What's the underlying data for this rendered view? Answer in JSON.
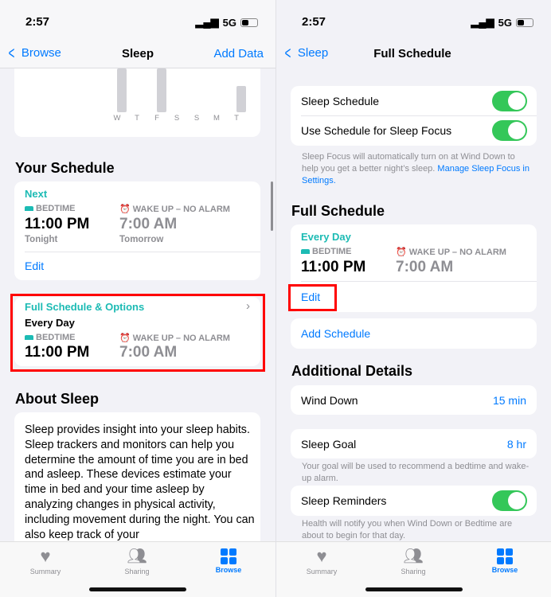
{
  "colors": {
    "accent": "#007aff",
    "teal": "#1cbbb4",
    "toggle_on": "#34c759",
    "highlight": "#ff0000"
  },
  "status": {
    "time": "2:57",
    "network": "5G"
  },
  "left": {
    "nav": {
      "back": "Browse",
      "title": "Sleep",
      "right": "Add Data"
    },
    "chart": {
      "days": [
        "W",
        "T",
        "F",
        "S",
        "S",
        "M",
        "T"
      ]
    },
    "your_schedule": {
      "title": "Your Schedule",
      "next": "Next",
      "bedtime_label": "BEDTIME",
      "bedtime": "11:00 PM",
      "bedtime_sub": "Tonight",
      "wake_label": "WAKE UP – NO ALARM",
      "wake": "7:00 AM",
      "wake_sub": "Tomorrow",
      "edit": "Edit"
    },
    "full_options": {
      "title": "Full Schedule & Options",
      "days": "Every Day",
      "bedtime_label": "BEDTIME",
      "bedtime": "11:00 PM",
      "wake_label": "WAKE UP – NO ALARM",
      "wake": "7:00 AM"
    },
    "about": {
      "title": "About Sleep",
      "text": "Sleep provides insight into your sleep habits. Sleep trackers and monitors can help you determine the amount of time you are in bed and asleep. These devices estimate your time in bed and your time asleep by analyzing changes in physical activity, including movement during the night. You can also keep track of your"
    }
  },
  "right": {
    "nav": {
      "back": "Sleep",
      "title": "Full Schedule"
    },
    "toggles": [
      {
        "label": "Sleep Schedule",
        "on": true
      },
      {
        "label": "Use Schedule for Sleep Focus",
        "on": true
      }
    ],
    "focus_note": "Sleep Focus will automatically turn on at Wind Down to help you get a better night’s sleep. ",
    "focus_link": "Manage Sleep Focus in Settings.",
    "full_schedule": {
      "title": "Full Schedule",
      "days": "Every Day",
      "bedtime_label": "BEDTIME",
      "bedtime": "11:00 PM",
      "wake_label": "WAKE UP – NO ALARM",
      "wake": "7:00 AM",
      "edit": "Edit"
    },
    "add_schedule": "Add Schedule",
    "additional": {
      "title": "Additional Details",
      "wind_down_label": "Wind Down",
      "wind_down_value": "15 min",
      "goal_label": "Sleep Goal",
      "goal_value": "8 hr",
      "goal_note": "Your goal will be used to recommend a bedtime and wake-up alarm.",
      "reminders_label": "Sleep Reminders",
      "reminders_on": true,
      "reminders_note": "Health will notify you when Wind Down or Bedtime are about to begin for that day."
    }
  },
  "tabs": [
    {
      "label": "Summary",
      "icon": "heart-icon"
    },
    {
      "label": "Sharing",
      "icon": "people-icon"
    },
    {
      "label": "Browse",
      "icon": "grid-icon",
      "active": true
    }
  ]
}
